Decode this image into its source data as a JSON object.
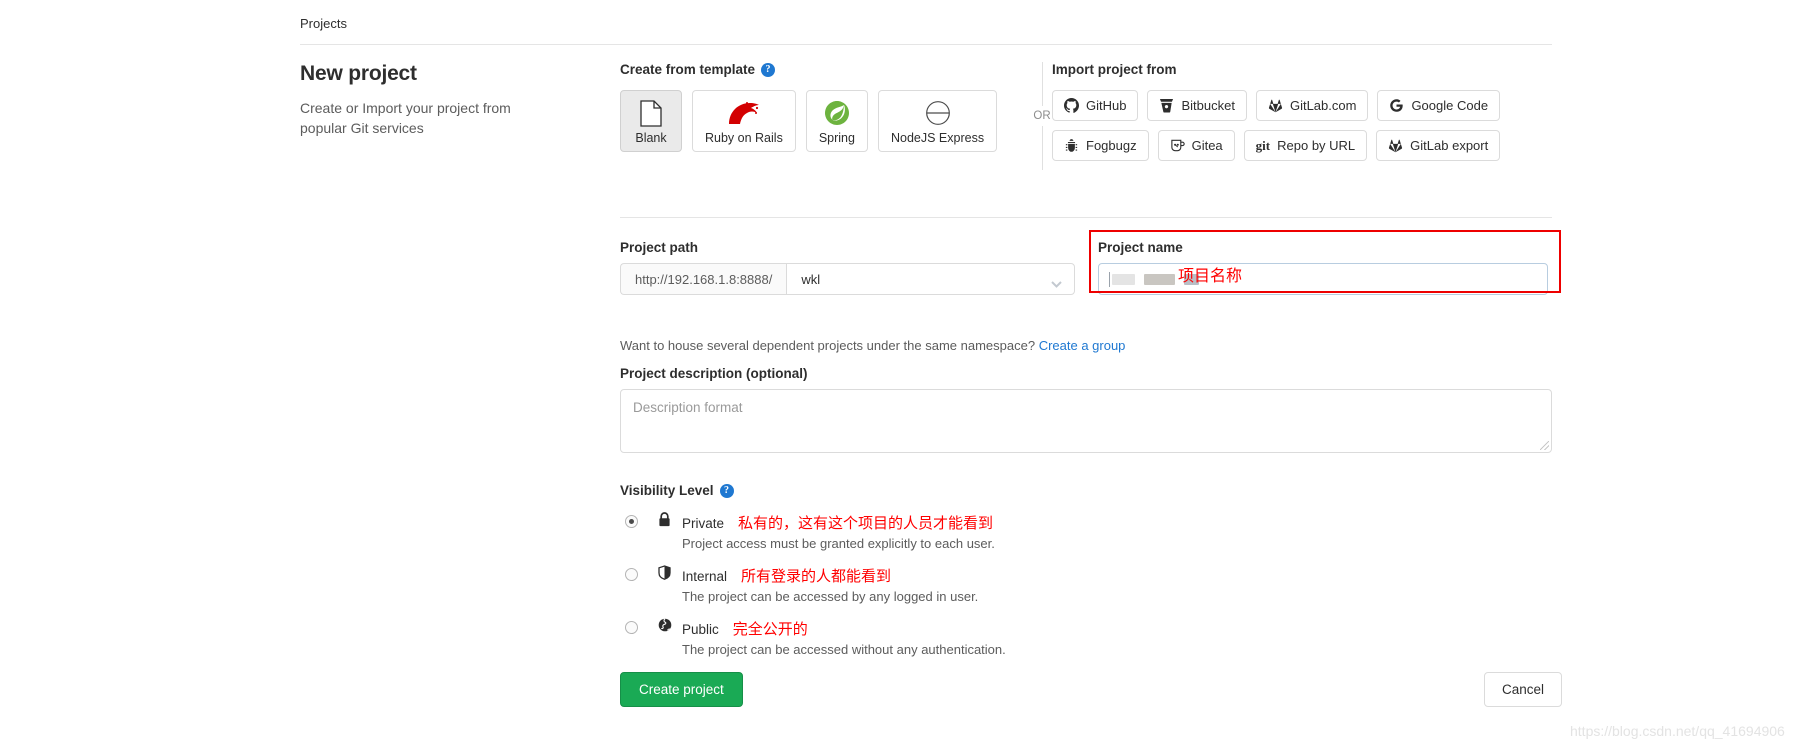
{
  "breadcrumb": {
    "label": "Projects"
  },
  "intro": {
    "title": "New project",
    "description": "Create or Import your project from popular Git services"
  },
  "template_section": {
    "label": "Create from template",
    "help_icon": "question-mark-icon",
    "cards": [
      {
        "label": "Blank",
        "icon": "blank-page-icon",
        "selected": true
      },
      {
        "label": "Ruby on Rails",
        "icon": "rails-icon",
        "selected": false
      },
      {
        "label": "Spring",
        "icon": "spring-leaf-icon",
        "selected": false
      },
      {
        "label": "NodeJS Express",
        "icon": "nodejs-express-icon",
        "selected": false
      }
    ]
  },
  "divider": {
    "label": "OR"
  },
  "import_section": {
    "label": "Import project from",
    "row1": [
      {
        "label": "GitHub",
        "icon": "github-icon"
      },
      {
        "label": "Bitbucket",
        "icon": "bitbucket-icon"
      },
      {
        "label": "GitLab.com",
        "icon": "gitlab-icon"
      },
      {
        "label": "Google Code",
        "icon": "google-icon"
      }
    ],
    "row2": [
      {
        "label": "Fogbugz",
        "icon": "bug-icon"
      },
      {
        "label": "Gitea",
        "icon": "gitea-icon"
      },
      {
        "label": "Repo by URL",
        "icon": "git-icon"
      },
      {
        "label": "GitLab export",
        "icon": "gitlab-icon"
      }
    ]
  },
  "project_path": {
    "label": "Project path",
    "prefix": "http://192.168.1.8:8888/",
    "namespace": "wkl",
    "dropdown_icon": "chevron-down-icon"
  },
  "project_name": {
    "label": "Project name",
    "value": "",
    "annotation": "项目名称",
    "annotation_color": "#ff0000",
    "highlight_color": "#ee0000"
  },
  "namespace_hint": {
    "text": "Want to house several dependent projects under the same namespace?",
    "link": "Create a group"
  },
  "project_description": {
    "label": "Project description (optional)",
    "placeholder": "Description format",
    "value": ""
  },
  "visibility": {
    "label": "Visibility Level",
    "help_icon": "question-mark-icon",
    "options": [
      {
        "name": "Private",
        "icon": "lock-icon",
        "selected": true,
        "description": "Project access must be granted explicitly to each user.",
        "annotation": "私有的，这有这个项目的人员才能看到"
      },
      {
        "name": "Internal",
        "icon": "shield-icon",
        "selected": false,
        "description": "The project can be accessed by any logged in user.",
        "annotation": "所有登录的人都能看到"
      },
      {
        "name": "Public",
        "icon": "globe-icon",
        "selected": false,
        "description": "The project can be accessed without any authentication.",
        "annotation": "完全公开的"
      }
    ]
  },
  "actions": {
    "create_label": "Create project",
    "create_color": "#1aaa55",
    "cancel_label": "Cancel"
  },
  "watermark": {
    "text": "https://blog.csdn.net/qq_41694906"
  }
}
